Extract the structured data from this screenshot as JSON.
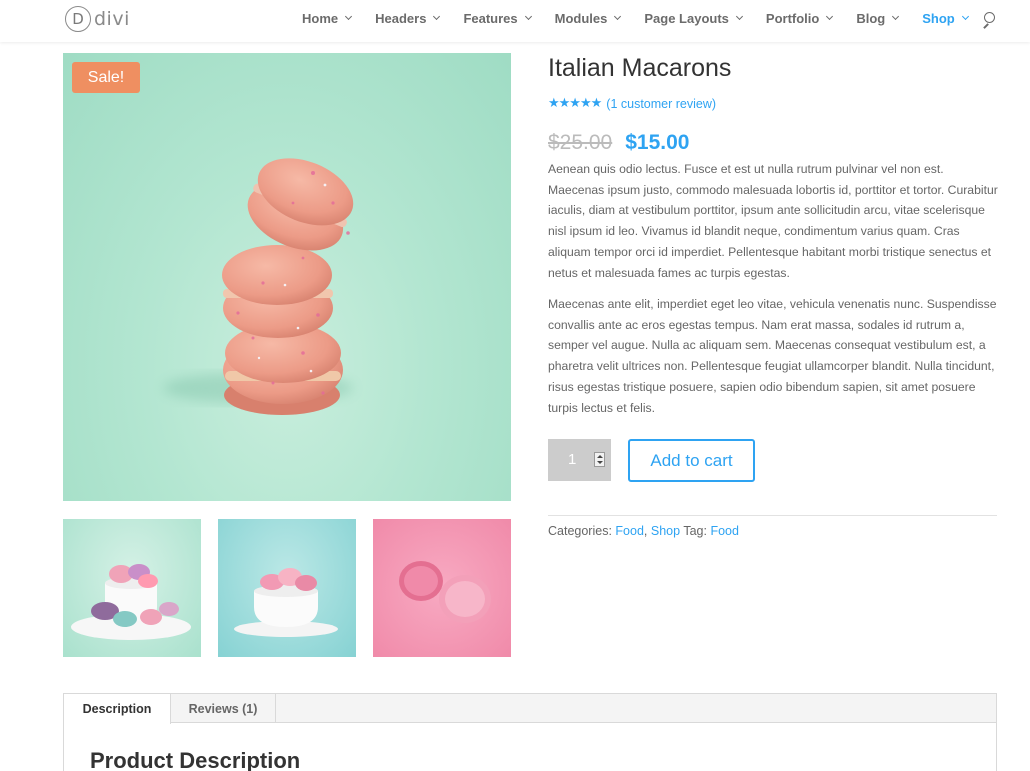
{
  "brand": {
    "logo_letter": "D",
    "name": "divi"
  },
  "nav": {
    "items": [
      {
        "label": "Home"
      },
      {
        "label": "Headers"
      },
      {
        "label": "Features"
      },
      {
        "label": "Modules"
      },
      {
        "label": "Page Layouts"
      },
      {
        "label": "Portfolio"
      },
      {
        "label": "Blog"
      },
      {
        "label": "Shop",
        "active": true
      }
    ],
    "search_icon": "search-icon"
  },
  "product": {
    "badge": "Sale!",
    "title": "Italian Macarons",
    "rating": {
      "stars": "★★★★★",
      "value": 5,
      "max": 5,
      "review_link": "(1 customer review)"
    },
    "price": {
      "old": "$25.00",
      "new": "$15.00"
    },
    "description": [
      "Aenean quis odio lectus. Fusce et est ut nulla rutrum pulvinar vel non est. Maecenas ipsum justo, commodo malesuada lobortis id, porttitor et tortor. Curabitur iaculis, diam at vestibulum porttitor, ipsum ante sollicitudin arcu, vitae scelerisque nisl ipsum id leo. Vivamus id blandit neque, condimentum varius quam. Cras aliquam tempor orci id imperdiet. Pellentesque habitant morbi tristique senectus et netus et malesuada fames ac turpis egestas.",
      "Maecenas ante elit, imperdiet eget leo vitae, vehicula venenatis nunc. Suspendisse convallis ante ac eros egestas tempus. Nam erat massa, sodales id rutrum a, semper vel augue. Nulla ac aliquam sem. Maecenas consequat vestibulum est, a pharetra velit ultrices non. Pellentesque feugiat ullamcorper blandit. Nulla tincidunt, risus egestas tristique posuere, sapien odio bibendum sapien, sit amet posuere turpis lectus et felis."
    ],
    "quantity": "1",
    "add_to_cart": "Add to cart",
    "meta": {
      "categories_label": "Categories:",
      "categories": [
        "Food",
        "Shop"
      ],
      "separator": ",",
      "tag_label": "Tag:",
      "tag": "Food"
    }
  },
  "tabs": [
    {
      "label": "Description",
      "active": true
    },
    {
      "label": "Reviews (1)"
    }
  ],
  "panel": {
    "title": "Product Description"
  },
  "colors": {
    "accent": "#2ea3f2",
    "sale": "#ef8f61",
    "price_old": "#bbbbbb"
  }
}
